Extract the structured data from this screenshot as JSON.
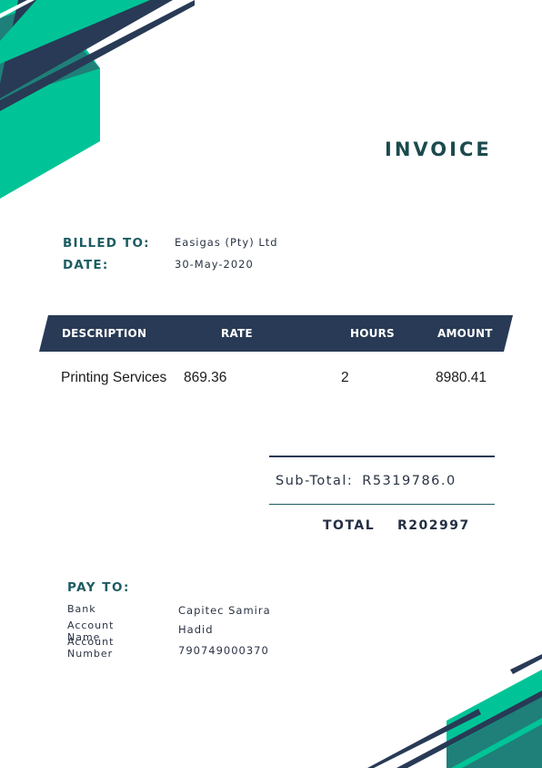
{
  "colors": {
    "teal": "#00c497",
    "dark_teal": "#1f7f79",
    "navy": "#283a55",
    "heading": "#1d5c63"
  },
  "title": "INVOICE",
  "billed_to": {
    "label": "BILLED TO:",
    "value": "Easigas (Pty) Ltd"
  },
  "date": {
    "label": "DATE:",
    "value": "30-May-2020"
  },
  "table": {
    "headers": [
      "DESCRIPTION",
      "RATE",
      "HOURS",
      "AMOUNT"
    ],
    "rows": [
      {
        "description": "Printing Services",
        "rate": "869.36",
        "hours": "2",
        "amount": "8980.41"
      }
    ]
  },
  "summary": {
    "subtotal_label": "Sub-Total:",
    "subtotal_value": "R5319786.0",
    "total_label": "TOTAL",
    "total_value": "R202997"
  },
  "pay_to": {
    "title": "PAY TO:",
    "bank_label": "Bank",
    "bank_value": "Capitec Samira",
    "account_name_label": "Account Name",
    "account_name_value": "Hadid",
    "account_number_label": "Account Number",
    "account_number_value": "790749000370"
  }
}
